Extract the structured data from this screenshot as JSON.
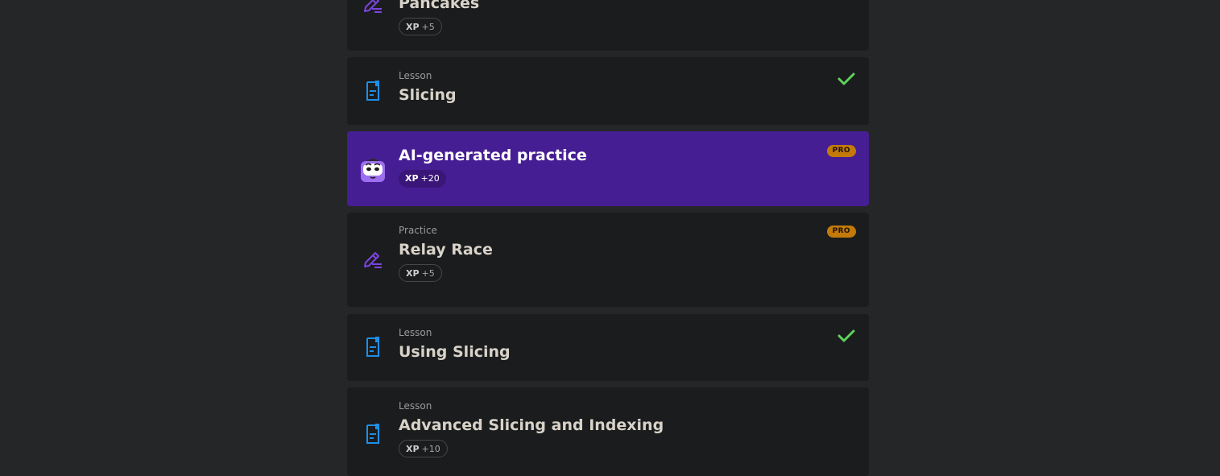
{
  "items": [
    {
      "type": "",
      "title": "Pancakes",
      "xp_label": "XP",
      "xp_value": "+5",
      "icon": "pencil-practice-icon"
    },
    {
      "type": "Lesson",
      "title": "Slicing",
      "icon": "lesson-document-icon",
      "completed": true
    },
    {
      "type": "",
      "title": "AI-generated practice",
      "xp_label": "XP",
      "xp_value": "+20",
      "badge": "PRO",
      "icon": "ai-robot-icon"
    },
    {
      "type": "Practice",
      "title": "Relay Race",
      "xp_label": "XP",
      "xp_value": "+5",
      "badge": "PRO",
      "icon": "pencil-practice-icon"
    },
    {
      "type": "Lesson",
      "title": "Using Slicing",
      "icon": "lesson-document-icon",
      "completed": true
    },
    {
      "type": "Lesson",
      "title": "Advanced Slicing and Indexing",
      "xp_label": "XP",
      "xp_value": "+10",
      "icon": "lesson-document-icon"
    }
  ],
  "colors": {
    "background": "#252628",
    "card": "#1b1c1e",
    "ai_card": "#461e93",
    "pro_badge": "#c47a0a",
    "check": "#5fd35b",
    "lesson_icon": "#1e8fe6",
    "practice_icon": "#7b45e0"
  }
}
